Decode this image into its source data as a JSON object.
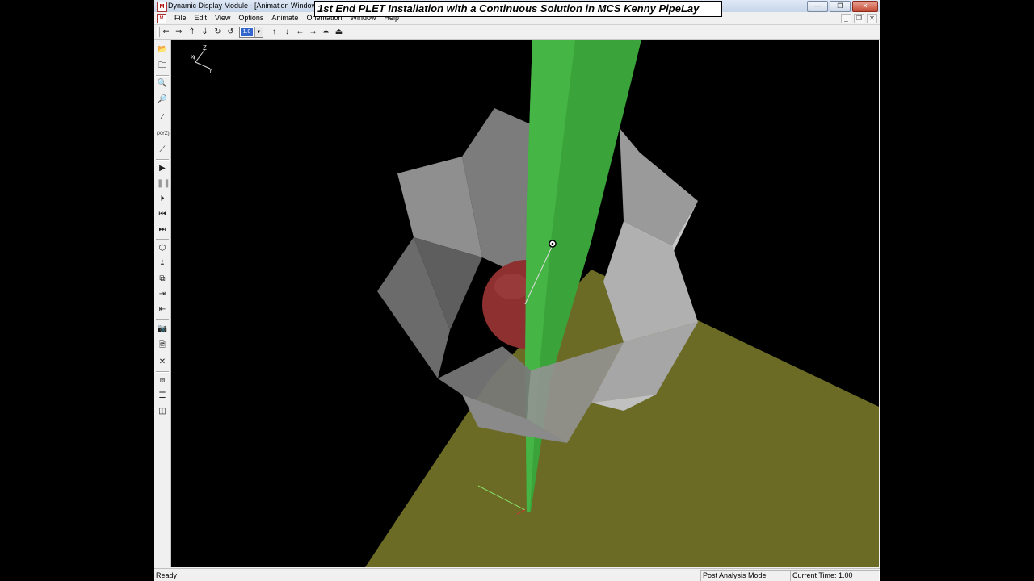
{
  "window": {
    "title": "Dynamic Display Module - [Animation Window]",
    "controls": [
      "—",
      "❐",
      "✕"
    ]
  },
  "video_title": "1st End PLET Installation with a Continuous Solution in MCS Kenny PipeLay",
  "menu": [
    "File",
    "Edit",
    "View",
    "Options",
    "Animate",
    "Orientation",
    "Window",
    "Help"
  ],
  "toolbar": {
    "zoom_value": "1.0"
  },
  "axes_labels": {
    "z": "Z",
    "x": "X",
    "y": "Y"
  },
  "status": {
    "left": "Ready",
    "mode": "Post Analysis Mode",
    "time_label": "Current Time:",
    "time_value": "1.00"
  },
  "colors": {
    "seabed": "#6b6b25",
    "pipe": "#3aa33a",
    "structure": "#8c8c8c",
    "sphere": "#8e3030",
    "background": "#000000"
  }
}
